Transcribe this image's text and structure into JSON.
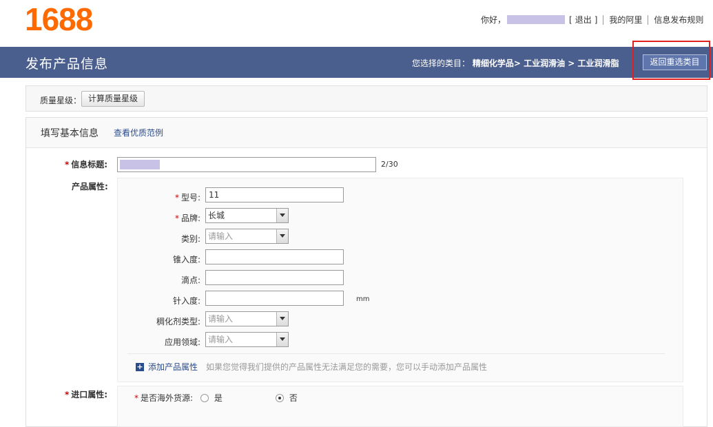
{
  "logo": "1688",
  "userbar": {
    "greeting": "你好，",
    "logout": "退出",
    "bracket_open": "[",
    "bracket_close": "]",
    "my_ali": "我的阿里",
    "rules": "信息发布规则"
  },
  "header": {
    "title": "发布产品信息",
    "category_label": "您选择的类目：",
    "category_path": "精细化学品> 工业润滑油 > 工业润滑脂",
    "reselect_button": "返回重选类目"
  },
  "quality": {
    "label": "质量星级：",
    "button": "计算质量星级"
  },
  "section": {
    "title": "填写基本信息",
    "example_link": "查看优质范例"
  },
  "info_title": {
    "label": "信息标题:",
    "counter": "2/30"
  },
  "product_attrs": {
    "label": "产品属性:",
    "fields": [
      {
        "label": "型号:",
        "required": true,
        "type": "text",
        "value": "11"
      },
      {
        "label": "品牌:",
        "required": true,
        "type": "select",
        "value": "长城"
      },
      {
        "label": "类别:",
        "required": false,
        "type": "select",
        "placeholder": "请输入"
      },
      {
        "label": "锥入度:",
        "required": false,
        "type": "text",
        "value": ""
      },
      {
        "label": "滴点:",
        "required": false,
        "type": "text",
        "value": ""
      },
      {
        "label": "针入度:",
        "required": false,
        "type": "text",
        "value": "",
        "unit": "mm"
      },
      {
        "label": "稠化剂类型:",
        "required": false,
        "type": "select",
        "placeholder": "请输入"
      },
      {
        "label": "应用领域:",
        "required": false,
        "type": "select",
        "placeholder": "请输入"
      }
    ],
    "add_link": "添加产品属性",
    "add_hint": "如果您觉得我们提供的产品属性无法满足您的需要，您可以手动添加产品属性"
  },
  "import_attrs": {
    "label": "进口属性:",
    "question": "是否海外货源:",
    "options": [
      "是",
      "否"
    ],
    "selected": "否"
  },
  "colors": {
    "brand_orange": "#ff6a00",
    "header_blue": "#4b5f8e",
    "link_blue": "#2b4c8c",
    "highlight_red": "#e0201f"
  }
}
